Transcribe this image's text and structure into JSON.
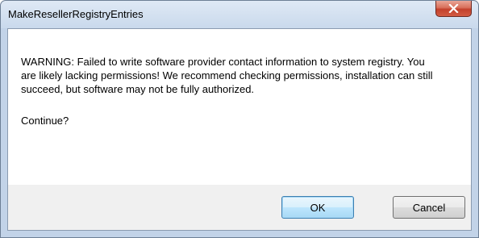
{
  "window": {
    "title": "MakeResellerRegistryEntries",
    "close_label": "X"
  },
  "message": {
    "text": "WARNING: Failed to write software provider contact information to system registry.  You are likely lacking permissions!  We recommend checking permissions, installation can still succeed, but software may not be fully authorized.",
    "question": "Continue?"
  },
  "buttons": {
    "ok_label": "OK",
    "cancel_label": "Cancel"
  },
  "icons": {
    "close": "close-icon"
  }
}
